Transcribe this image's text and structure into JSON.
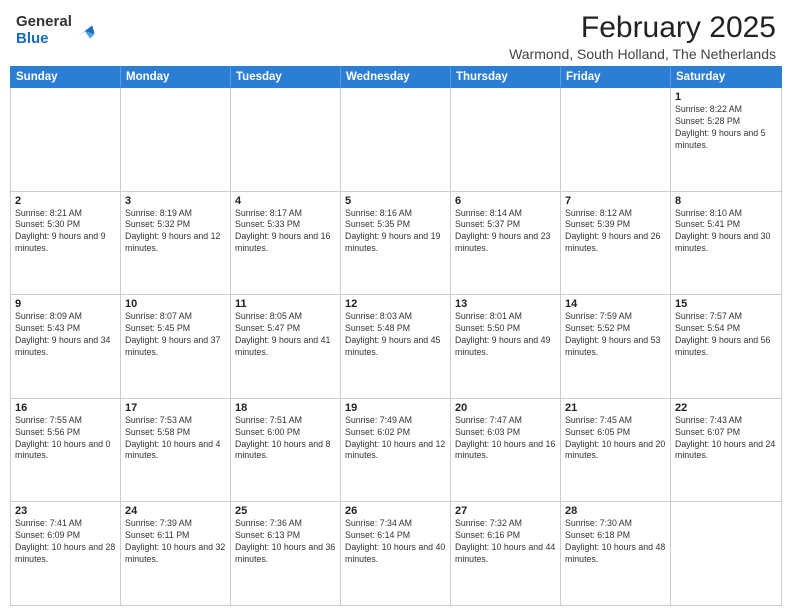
{
  "logo": {
    "general": "General",
    "blue": "Blue"
  },
  "header": {
    "month": "February 2025",
    "location": "Warmond, South Holland, The Netherlands"
  },
  "weekdays": [
    "Sunday",
    "Monday",
    "Tuesday",
    "Wednesday",
    "Thursday",
    "Friday",
    "Saturday"
  ],
  "rows": [
    [
      {
        "day": "",
        "info": ""
      },
      {
        "day": "",
        "info": ""
      },
      {
        "day": "",
        "info": ""
      },
      {
        "day": "",
        "info": ""
      },
      {
        "day": "",
        "info": ""
      },
      {
        "day": "",
        "info": ""
      },
      {
        "day": "1",
        "info": "Sunrise: 8:22 AM\nSunset: 5:28 PM\nDaylight: 9 hours and 5 minutes."
      }
    ],
    [
      {
        "day": "2",
        "info": "Sunrise: 8:21 AM\nSunset: 5:30 PM\nDaylight: 9 hours and 9 minutes."
      },
      {
        "day": "3",
        "info": "Sunrise: 8:19 AM\nSunset: 5:32 PM\nDaylight: 9 hours and 12 minutes."
      },
      {
        "day": "4",
        "info": "Sunrise: 8:17 AM\nSunset: 5:33 PM\nDaylight: 9 hours and 16 minutes."
      },
      {
        "day": "5",
        "info": "Sunrise: 8:16 AM\nSunset: 5:35 PM\nDaylight: 9 hours and 19 minutes."
      },
      {
        "day": "6",
        "info": "Sunrise: 8:14 AM\nSunset: 5:37 PM\nDaylight: 9 hours and 23 minutes."
      },
      {
        "day": "7",
        "info": "Sunrise: 8:12 AM\nSunset: 5:39 PM\nDaylight: 9 hours and 26 minutes."
      },
      {
        "day": "8",
        "info": "Sunrise: 8:10 AM\nSunset: 5:41 PM\nDaylight: 9 hours and 30 minutes."
      }
    ],
    [
      {
        "day": "9",
        "info": "Sunrise: 8:09 AM\nSunset: 5:43 PM\nDaylight: 9 hours and 34 minutes."
      },
      {
        "day": "10",
        "info": "Sunrise: 8:07 AM\nSunset: 5:45 PM\nDaylight: 9 hours and 37 minutes."
      },
      {
        "day": "11",
        "info": "Sunrise: 8:05 AM\nSunset: 5:47 PM\nDaylight: 9 hours and 41 minutes."
      },
      {
        "day": "12",
        "info": "Sunrise: 8:03 AM\nSunset: 5:48 PM\nDaylight: 9 hours and 45 minutes."
      },
      {
        "day": "13",
        "info": "Sunrise: 8:01 AM\nSunset: 5:50 PM\nDaylight: 9 hours and 49 minutes."
      },
      {
        "day": "14",
        "info": "Sunrise: 7:59 AM\nSunset: 5:52 PM\nDaylight: 9 hours and 53 minutes."
      },
      {
        "day": "15",
        "info": "Sunrise: 7:57 AM\nSunset: 5:54 PM\nDaylight: 9 hours and 56 minutes."
      }
    ],
    [
      {
        "day": "16",
        "info": "Sunrise: 7:55 AM\nSunset: 5:56 PM\nDaylight: 10 hours and 0 minutes."
      },
      {
        "day": "17",
        "info": "Sunrise: 7:53 AM\nSunset: 5:58 PM\nDaylight: 10 hours and 4 minutes."
      },
      {
        "day": "18",
        "info": "Sunrise: 7:51 AM\nSunset: 6:00 PM\nDaylight: 10 hours and 8 minutes."
      },
      {
        "day": "19",
        "info": "Sunrise: 7:49 AM\nSunset: 6:02 PM\nDaylight: 10 hours and 12 minutes."
      },
      {
        "day": "20",
        "info": "Sunrise: 7:47 AM\nSunset: 6:03 PM\nDaylight: 10 hours and 16 minutes."
      },
      {
        "day": "21",
        "info": "Sunrise: 7:45 AM\nSunset: 6:05 PM\nDaylight: 10 hours and 20 minutes."
      },
      {
        "day": "22",
        "info": "Sunrise: 7:43 AM\nSunset: 6:07 PM\nDaylight: 10 hours and 24 minutes."
      }
    ],
    [
      {
        "day": "23",
        "info": "Sunrise: 7:41 AM\nSunset: 6:09 PM\nDaylight: 10 hours and 28 minutes."
      },
      {
        "day": "24",
        "info": "Sunrise: 7:39 AM\nSunset: 6:11 PM\nDaylight: 10 hours and 32 minutes."
      },
      {
        "day": "25",
        "info": "Sunrise: 7:36 AM\nSunset: 6:13 PM\nDaylight: 10 hours and 36 minutes."
      },
      {
        "day": "26",
        "info": "Sunrise: 7:34 AM\nSunset: 6:14 PM\nDaylight: 10 hours and 40 minutes."
      },
      {
        "day": "27",
        "info": "Sunrise: 7:32 AM\nSunset: 6:16 PM\nDaylight: 10 hours and 44 minutes."
      },
      {
        "day": "28",
        "info": "Sunrise: 7:30 AM\nSunset: 6:18 PM\nDaylight: 10 hours and 48 minutes."
      },
      {
        "day": "",
        "info": ""
      }
    ]
  ]
}
